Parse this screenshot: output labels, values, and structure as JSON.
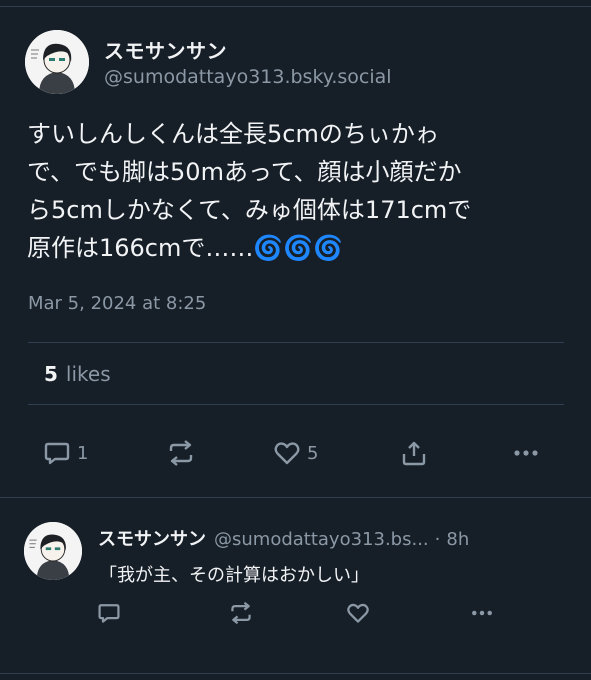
{
  "post": {
    "author_name": "スモサンサン",
    "author_handle": "@sumodattayo313.bsky.social",
    "text_lines": [
      "すいしんしくんは全長5cmのちぃかゎ",
      "で、でも脚は50mあって、顔は小顔だか",
      "ら5cmしかなくて、みゅ個体は171cmで",
      "原作は166cmで……🌀🌀🌀"
    ],
    "timestamp": "Mar 5, 2024 at 8:25",
    "likes_count": "5",
    "likes_label": "likes",
    "actions": {
      "reply_count": "1",
      "repost_count": "",
      "like_count": "5"
    }
  },
  "reply": {
    "author_name": "スモサンサン",
    "author_handle": "@sumodattayo313.bs...",
    "separator": "·",
    "time": "8h",
    "text": "「我が主、その計算はおかしい」"
  },
  "colors": {
    "background": "#161e27",
    "text_primary": "#f1f3f5",
    "text_secondary": "#8b98a5",
    "divider": "#2e4052"
  },
  "icons": [
    "reply-icon",
    "repost-icon",
    "like-icon",
    "share-icon",
    "more-icon"
  ]
}
